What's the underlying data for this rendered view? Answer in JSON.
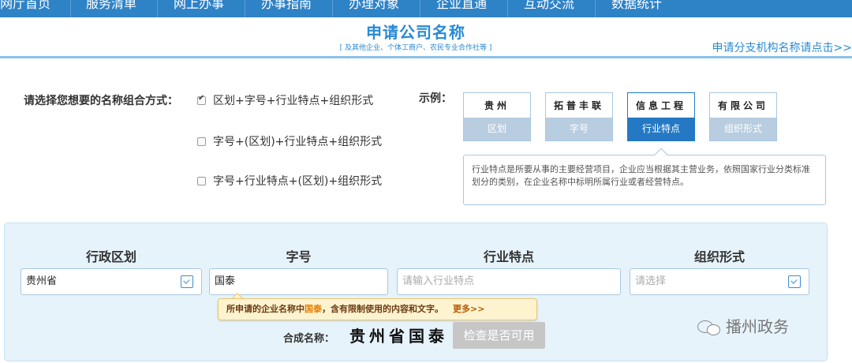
{
  "nav": {
    "items": [
      "网厅首页",
      "服务清单",
      "网上办事",
      "办事指南",
      "办理对象",
      "企业直通",
      "互动交流",
      "数据统计"
    ]
  },
  "header": {
    "title": "申请公司名称",
    "subtitle": "[ 及其他企业、个体工商户、农民专业合作社等 ]",
    "branch_link": "申请分支机构名称请点击>>"
  },
  "combination": {
    "label": "请选择您想要的名称组合方式：",
    "options": [
      {
        "label": "区划+字号+行业特点+组织形式",
        "checked": true
      },
      {
        "label": "字号+(区划)+行业特点+组织形式",
        "checked": false
      },
      {
        "label": "字号+行业特点+(区划)+组织形式",
        "checked": false
      }
    ]
  },
  "example": {
    "label": "示例：",
    "cards": [
      {
        "word": "贵州",
        "tag": "区划",
        "active": false
      },
      {
        "word": "拓普丰联",
        "tag": "字号",
        "active": false
      },
      {
        "word": "信息工程",
        "tag": "行业特点",
        "active": true
      },
      {
        "word": "有限公司",
        "tag": "组织形式",
        "active": false
      }
    ],
    "description": "行业特点是所要从事的主要经营项目，企业应当根据其主营业务，依照国家行业分类标准划分的类别，在企业名称中标明所属行业或者经营特点。"
  },
  "form": {
    "columns": [
      "行政区划",
      "字号",
      "行业特点",
      "组织形式"
    ],
    "region_value": "贵州省",
    "tradename_value": "国泰",
    "industry_placeholder": "请输入行业特点",
    "orgform_placeholder": "请选择",
    "warning": {
      "prefix": "所申请的企业名称中",
      "highlight": "国泰",
      "suffix": "，含有限制使用的内容和文字。",
      "more": "更多>>"
    },
    "compose_label": "合成名称：",
    "compose_value": "贵州省国泰",
    "check_button": "检查是否可用"
  },
  "watermark": {
    "text": "播州政务",
    "icon": "wechat-icon"
  },
  "colors": {
    "nav_bg": "#2e82c6",
    "accent": "#2a8ad4",
    "active_card": "#2579c4",
    "panel_bg": "#e6f3fb",
    "warning_bg": "#fdf3cf",
    "warning_highlight": "#e67e00",
    "disabled_button": "#c6c6c6"
  }
}
